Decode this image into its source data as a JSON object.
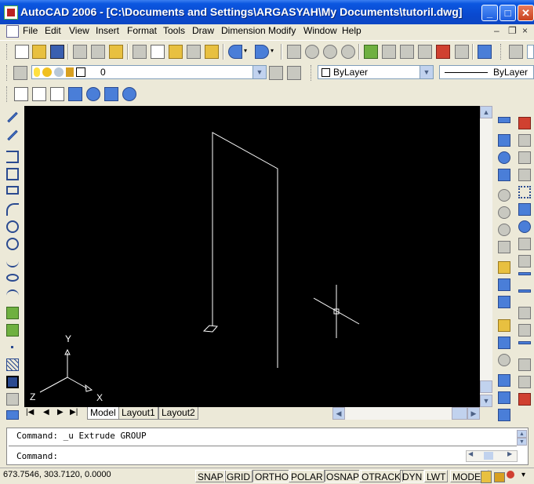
{
  "window": {
    "title": "AutoCAD 2006 - [C:\\Documents and Settings\\ARGASYAH\\My Documents\\tutoril.dwg]",
    "minimize": "_",
    "maximize": "□",
    "close": "✕"
  },
  "menu": {
    "items": [
      "File",
      "Edit",
      "View",
      "Insert",
      "Format",
      "Tools",
      "Draw",
      "Dimension",
      "Modify",
      "Window",
      "Help"
    ],
    "doc_minimize": "–",
    "doc_restore": "❐",
    "doc_close": "×"
  },
  "layers_toolbar": {
    "layer_name": "0",
    "color_value": "ByLayer",
    "linetype_value": "ByLayer"
  },
  "canvas": {
    "background": "#000000",
    "ucs": {
      "x_label": "X",
      "y_label": "Y",
      "z_label": "Z"
    }
  },
  "tabs": {
    "model": "Model",
    "layout1": "Layout1",
    "layout2": "Layout2"
  },
  "command": {
    "history_line": "Command: _u Extrude GROUP",
    "prompt": "Command:"
  },
  "status": {
    "coordinates": "673.7546, 303.7120, 0.0000",
    "toggles": [
      "SNAP",
      "GRID",
      "ORTHO",
      "POLAR",
      "OSNAP",
      "OTRACK",
      "DYN",
      "LWT",
      "MODEL"
    ]
  }
}
